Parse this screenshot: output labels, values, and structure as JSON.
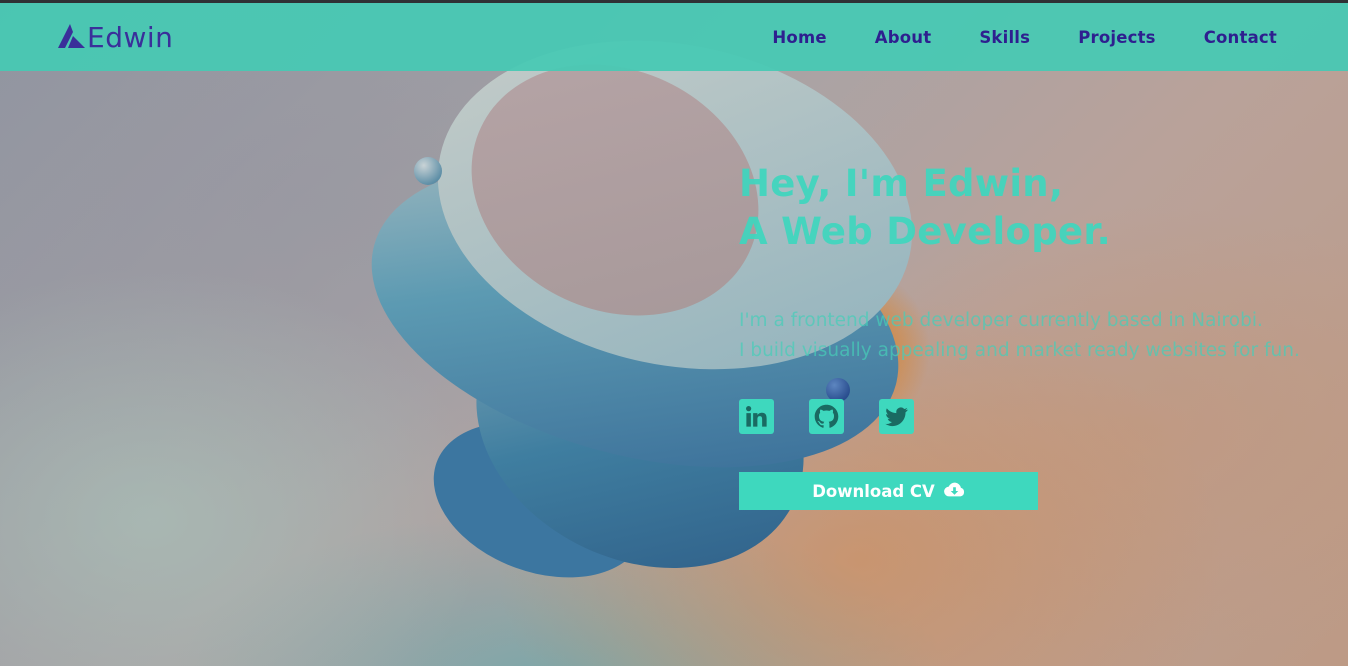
{
  "brand": {
    "name": "Edwin",
    "logo_icon": "triangle-a-logo-icon",
    "color": "#3a2f9a"
  },
  "nav": {
    "items": [
      {
        "label": "Home"
      },
      {
        "label": "About"
      },
      {
        "label": "Skills"
      },
      {
        "label": "Projects"
      },
      {
        "label": "Contact"
      }
    ],
    "background": "#46c9b4",
    "link_color": "#2e1f8f"
  },
  "hero": {
    "headline_line1": "Hey, I'm Edwin,",
    "headline_line2": "A Web Developer.",
    "subtitle_line1": "I'm a frontend web developer currently based in Nairobi.",
    "subtitle_line2": "I build visually appealing and market ready websites for fun.",
    "accent": "#3ed8be"
  },
  "socials": [
    {
      "name": "LinkedIn",
      "icon": "linkedin-icon"
    },
    {
      "name": "GitHub",
      "icon": "github-icon"
    },
    {
      "name": "Twitter",
      "icon": "twitter-icon"
    }
  ],
  "cta": {
    "label": "Download CV",
    "icon": "cloud-download-icon"
  }
}
